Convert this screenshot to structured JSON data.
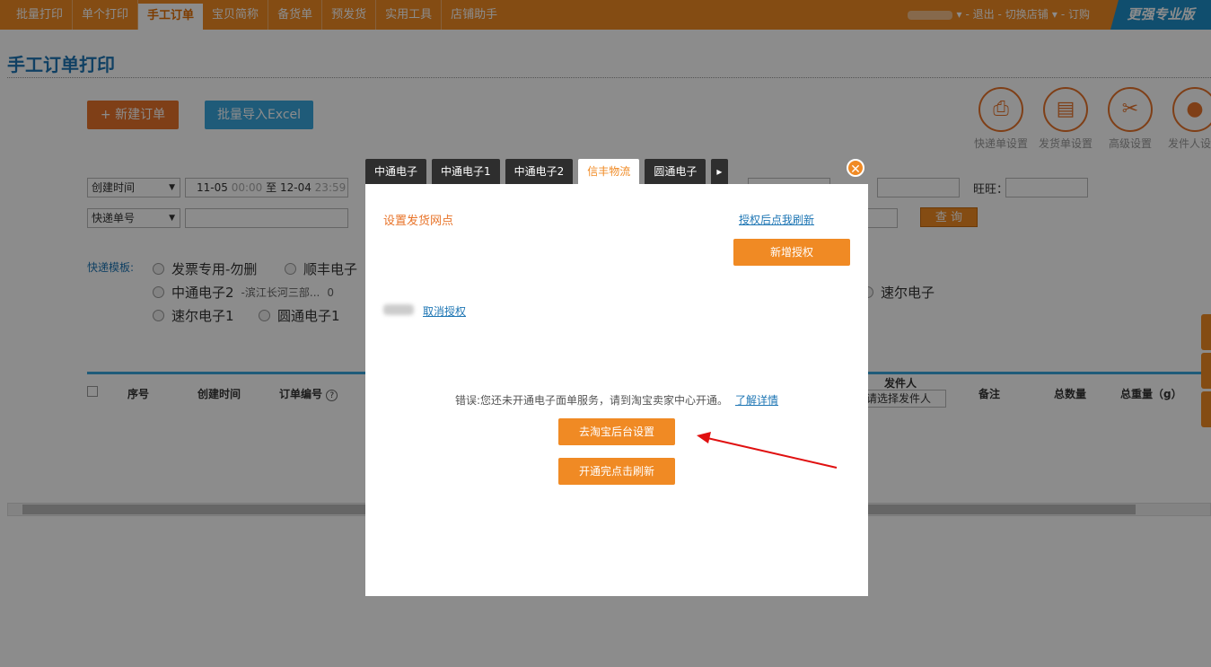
{
  "nav": {
    "items": [
      "批量打印",
      "单个打印",
      "手工订单",
      "宝贝简称",
      "备货单",
      "预发货",
      "实用工具",
      "店铺助手"
    ],
    "active_index": 2
  },
  "user_links": {
    "logout": "- 退出 -",
    "switch_shop": "切换店铺",
    "order": "- 订购",
    "arrow": "▾"
  },
  "pro_badge": "更强专业版",
  "page_title": "手工订单打印",
  "buttons": {
    "new_order": "+ 新建订单",
    "import_excel": "批量导入Excel"
  },
  "tools": [
    {
      "label": "快递单设置",
      "icon": "printer-icon"
    },
    {
      "label": "发货单设置",
      "icon": "invoice-icon"
    },
    {
      "label": "高级设置",
      "icon": "tools-icon"
    },
    {
      "label": "发件人设置",
      "icon": "person-icon"
    }
  ],
  "filters": {
    "created_time_select": "创建时间",
    "date_from": "11-05",
    "time_from": "00:00",
    "to": "至",
    "date_to": "12-04",
    "time_to": "23:59",
    "express_no_select": "快递单号",
    "wangwang_label": "旺旺：",
    "query": "查 询"
  },
  "templates": {
    "label": "快递模板:",
    "options": [
      {
        "name": "发票专用-勿删",
        "note": ""
      },
      {
        "name": "顺丰电子",
        "note": ""
      },
      {
        "name": "中通电子2",
        "note": "-滨江长河三部...",
        "count": "0"
      },
      {
        "name": "速尔电子",
        "note": ""
      },
      {
        "name": "速尔电子1",
        "note": ""
      },
      {
        "name": "圆通电子1",
        "note": ""
      }
    ]
  },
  "table_headers": {
    "seq": "序号",
    "created": "创建时间",
    "order_no": "订单编号",
    "order_no_help": "?",
    "sender": "发件人",
    "sender_select": "请选择发件人",
    "remark": "备注",
    "total_qty": "总数量",
    "total_weight": "总重量（g）"
  },
  "dialog": {
    "tabs": [
      "中通电子",
      "中通电子1",
      "中通电子2",
      "信丰物流",
      "圆通电子"
    ],
    "active_tab": 3,
    "more_arrow": "▸",
    "close": "✕",
    "title": "设置发货网点",
    "refresh_link": "授权后点我刷新",
    "add_auth": "新增授权",
    "cancel_auth": "取消授权",
    "error_text": "错误:您还未开通电子面单服务，请到淘宝卖家中心开通。",
    "learn_more": "了解详情",
    "goto_taobao": "去淘宝后台设置",
    "refresh_after": "开通完点击刷新"
  },
  "colors": {
    "accent": "#f08a24",
    "link": "#1e76b4",
    "overlay": "rgba(0,0,0,0.45)"
  }
}
